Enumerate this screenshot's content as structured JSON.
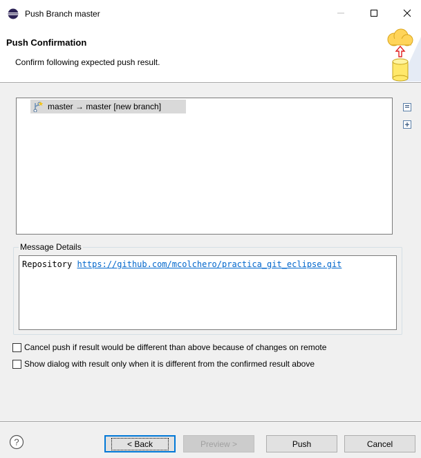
{
  "window": {
    "title": "Push Branch master",
    "icon": "eclipse-icon",
    "minimize_icon": "minimize-icon",
    "maximize_icon": "maximize-icon",
    "close_icon": "close-icon"
  },
  "header": {
    "title": "Push Confirmation",
    "description": "Confirm following expected push result.",
    "image_icon": "cloud-push-repository-icon"
  },
  "tree": {
    "rows": [
      {
        "label": "master → master [new branch]",
        "icon": "new-branch-icon"
      }
    ],
    "toolbar": {
      "collapse_icon": "collapse-all-icon",
      "expand_icon": "expand-all-icon"
    }
  },
  "message_details": {
    "label": "Message Details",
    "prefix": "Repository ",
    "link": "https://github.com/mcolchero/practica_git_eclipse.git"
  },
  "options": {
    "cancel_if_different": {
      "label": "Cancel push if result would be different than above because of changes on remote",
      "checked": false
    },
    "show_dialog_only_if_different": {
      "label": "Show dialog with result only when it is different from the confirmed result above",
      "checked": false
    }
  },
  "footer": {
    "help_icon": "help-icon",
    "back_label": "< Back",
    "preview_label": "Preview >",
    "push_label": "Push",
    "cancel_label": "Cancel"
  },
  "colors": {
    "accent": "#0078d7",
    "link": "#0066cc",
    "selection": "#d9d9d9"
  }
}
